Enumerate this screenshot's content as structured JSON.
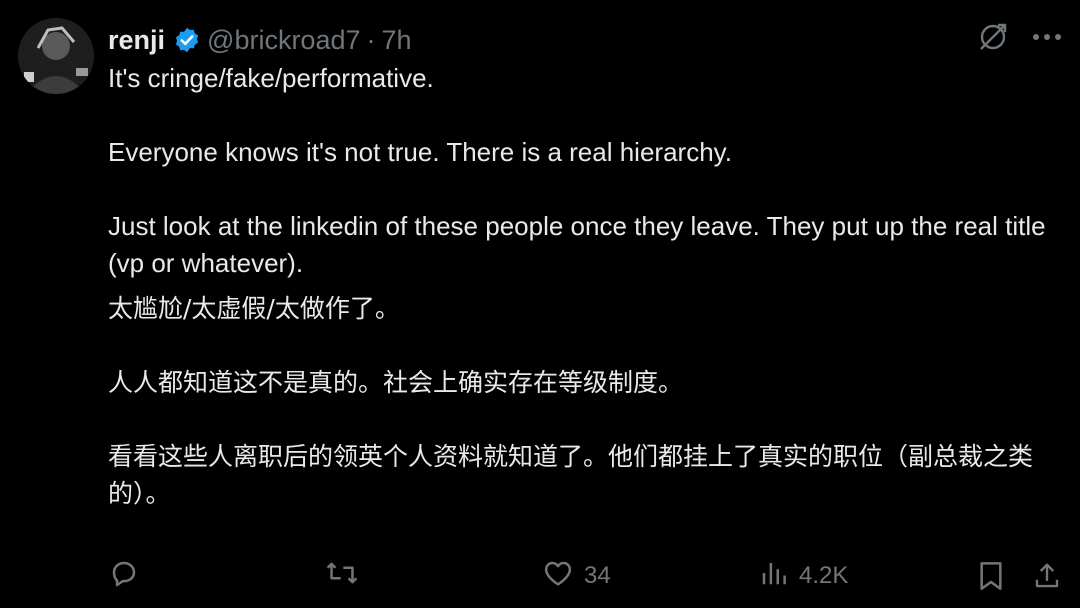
{
  "tweet": {
    "author": {
      "name": "renji",
      "handle": "@brickroad7",
      "separator": "·",
      "time": "7h"
    },
    "paragraphs_en": [
      "It's cringe/fake/performative.",
      "Everyone knows it's not true. There is a real hierarchy.",
      "Just look at the linkedin of these people once they leave. They put up the real title (vp or whatever)."
    ],
    "paragraphs_zh": [
      "太尴尬/太虚假/太做作了。",
      "人人都知道这不是真的。社会上确实存在等级制度。",
      "看看这些人离职后的领英个人资料就知道了。他们都挂上了真实的职位（副总裁之类的）。"
    ],
    "stats": {
      "likes": "34",
      "views": "4.2K"
    }
  },
  "colors": {
    "background": "#000000",
    "text": "#e7e9ea",
    "muted": "#71767b",
    "verified": "#1d9bf0"
  },
  "icons": {
    "verified": "verified-badge-icon",
    "grok": "grok-icon",
    "more": "more-icon",
    "reply": "reply-icon",
    "retweet": "retweet-icon",
    "like": "heart-icon",
    "views": "views-icon",
    "bookmark": "bookmark-icon",
    "share": "share-icon"
  }
}
